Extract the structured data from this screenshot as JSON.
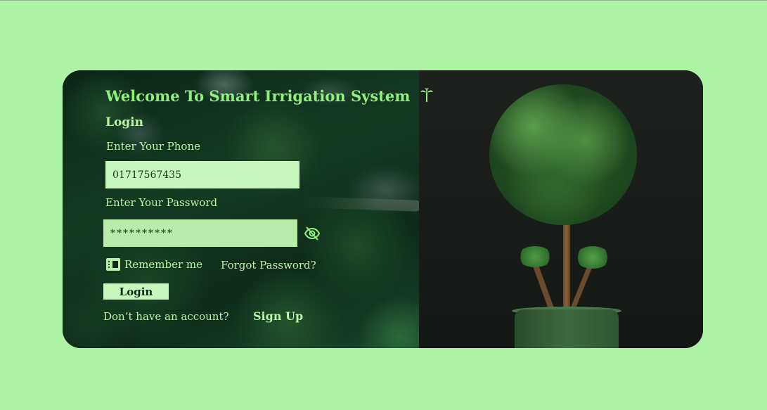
{
  "page": {
    "background_color": "#aef2a6",
    "accent_color": "#8ff07c"
  },
  "form": {
    "title": "Welcome To Smart Irrigation System",
    "title_icon": "palm-tree-icon",
    "heading": "Login",
    "phone_label": "Enter Your Phone",
    "phone_value": "01717567435",
    "password_label": "Enter Your Password",
    "password_value": "**********",
    "password_toggle_icon": "eye-off-icon",
    "remember_label": "Remember me",
    "remember_checked": true,
    "forgot_label": "Forgot Password?",
    "login_button_label": "Login",
    "no_account_text": "Don’t have an account?",
    "signup_label": "Sign Up"
  }
}
